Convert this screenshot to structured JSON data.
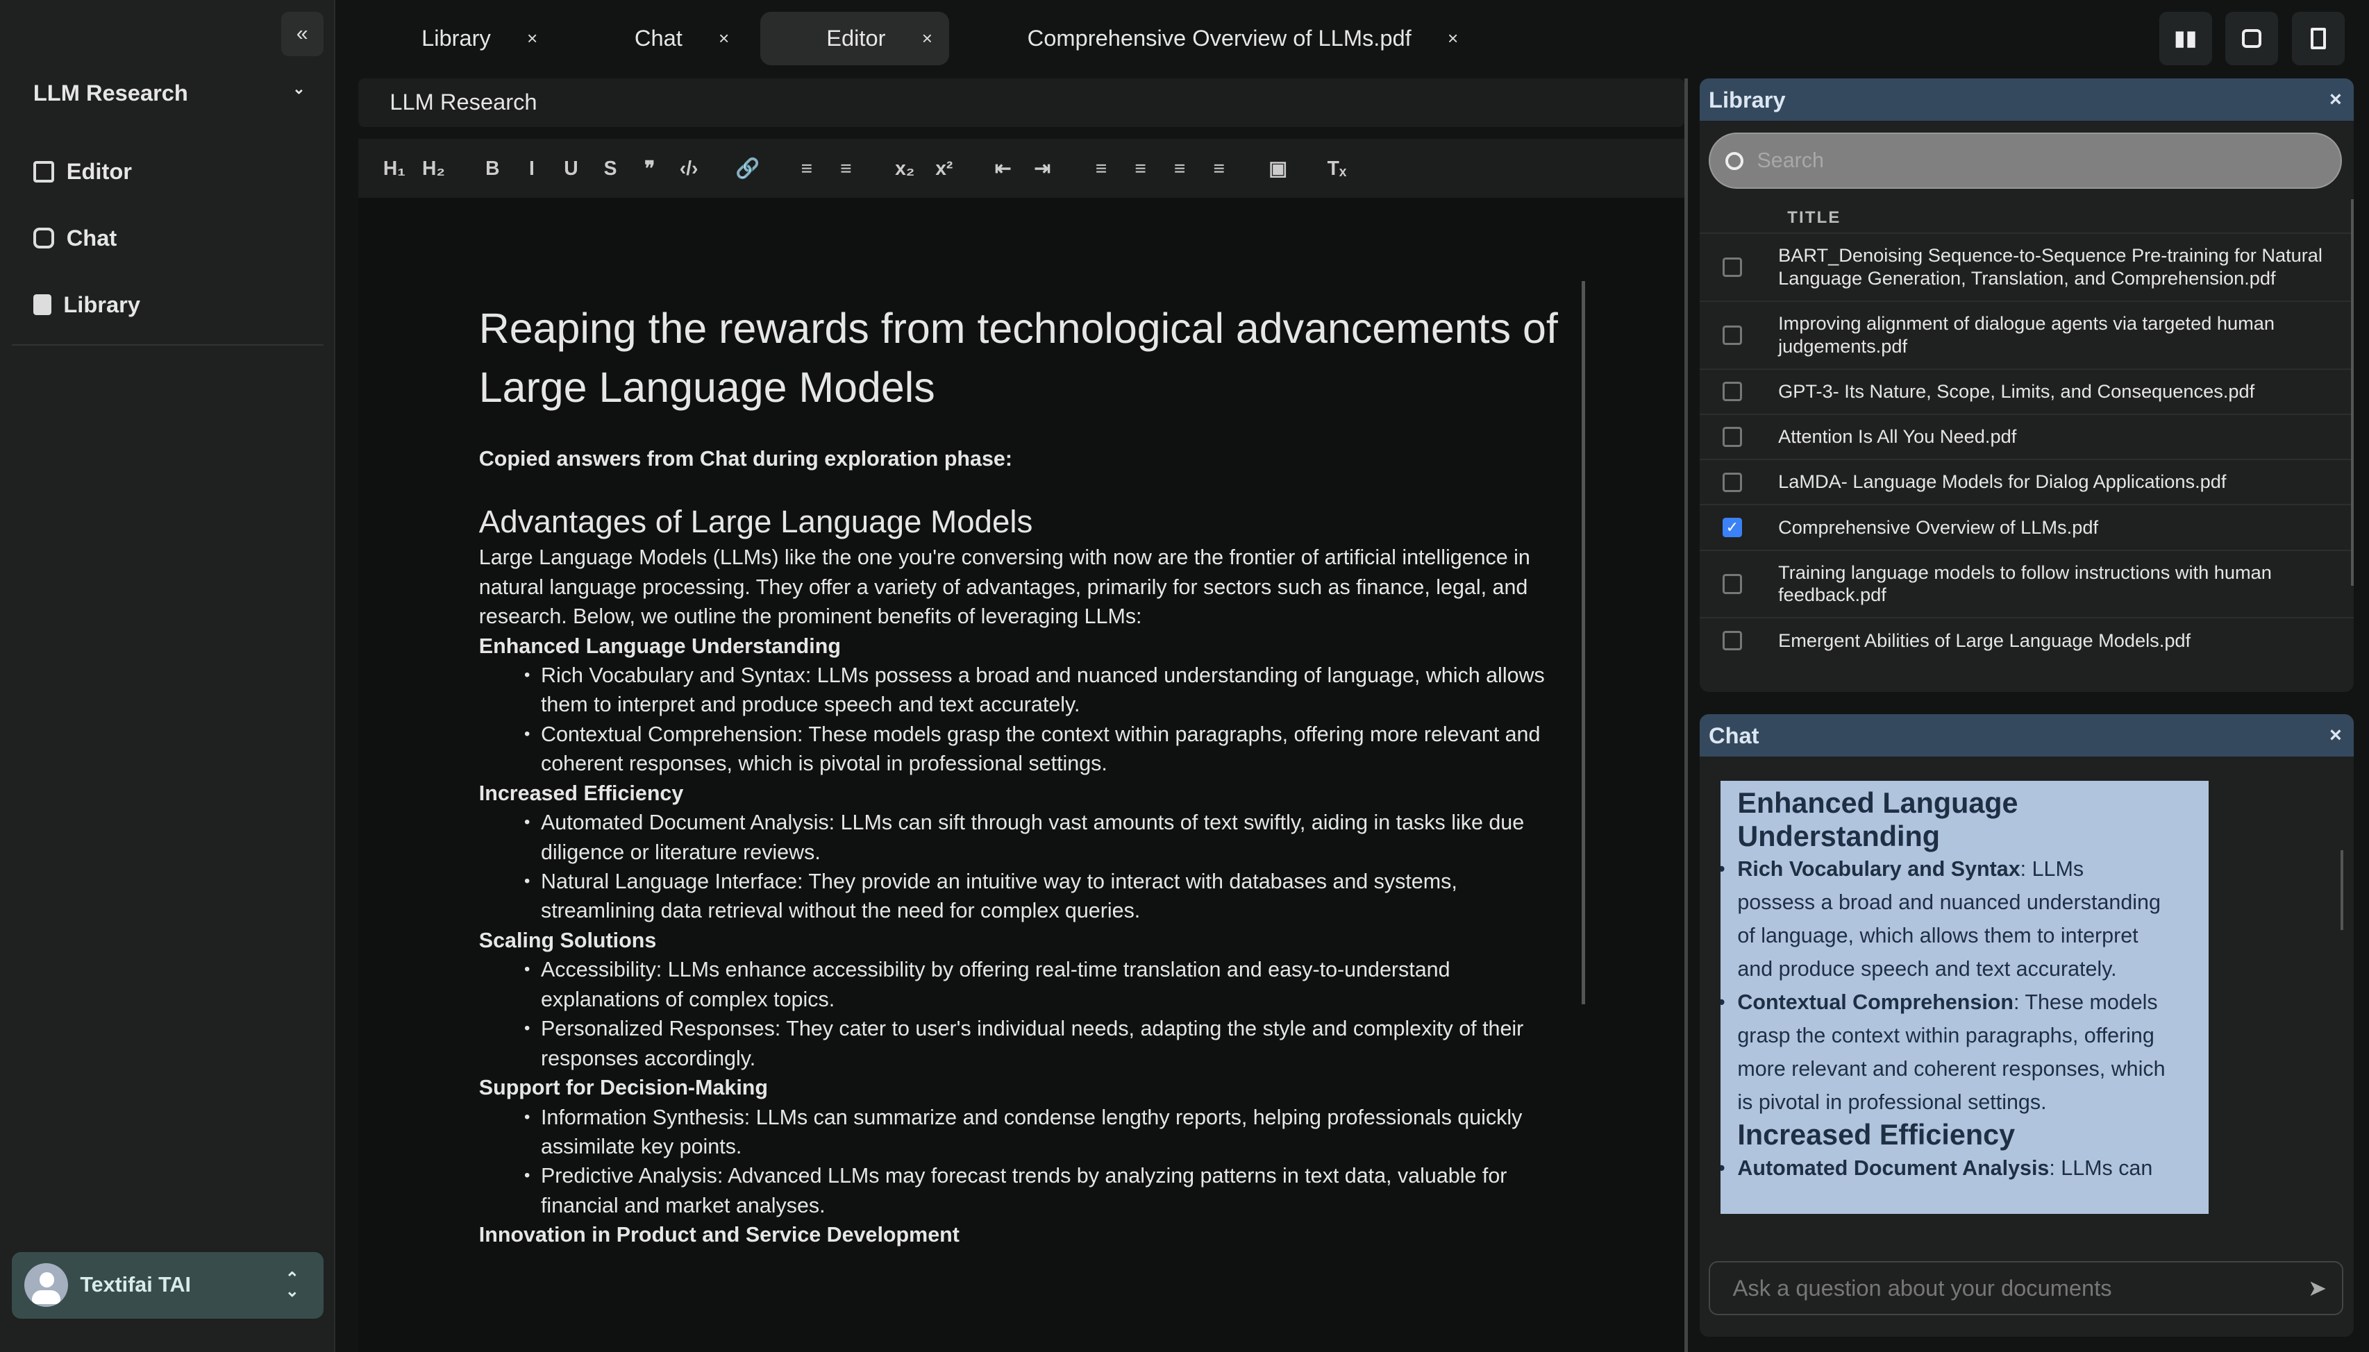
{
  "sidebar": {
    "collapse": "«",
    "workspace": "LLM Research",
    "nav": [
      {
        "label": "Editor"
      },
      {
        "label": "Chat"
      },
      {
        "label": "Library"
      }
    ],
    "user": "Textifai TAI"
  },
  "tabs": [
    {
      "label": "Library"
    },
    {
      "label": "Chat"
    },
    {
      "label": "Editor",
      "active": true
    },
    {
      "label": "Comprehensive Overview of LLMs.pdf"
    }
  ],
  "tab_close": "×",
  "editor": {
    "doc_title": "LLM Research",
    "toolbar": [
      "H₁",
      "H₂",
      "B",
      "I",
      "U",
      "S",
      "❞",
      "‹/›",
      "🔗",
      "≡",
      "≡",
      "x₂",
      "x²",
      "⇤",
      "⇥",
      "≡",
      "≡",
      "≡",
      "≡",
      "▣",
      "Tₓ"
    ],
    "heading": "Reaping the rewards from technological advancements of Large Language Models",
    "intro": "Copied answers from Chat during exploration phase:",
    "h2": "Advantages of Large Language Models",
    "para": "Large Language Models (LLMs) like the one you're conversing with now are the frontier of artificial intelligence in natural language processing. They offer a variety of advantages, primarily for sectors such as finance, legal, and research. Below, we outline the prominent benefits of leveraging LLMs:",
    "sections": [
      {
        "title": "Enhanced Language Understanding",
        "items": [
          "Rich Vocabulary and Syntax: LLMs possess a broad and nuanced understanding of language, which allows them to interpret and produce speech and text accurately.",
          "Contextual Comprehension: These models grasp the context within paragraphs, offering more relevant and coherent responses, which is pivotal in professional settings."
        ]
      },
      {
        "title": "Increased Efficiency",
        "items": [
          "Automated Document Analysis: LLMs can sift through vast amounts of text swiftly, aiding in tasks like due diligence or literature reviews.",
          "Natural Language Interface: They provide an intuitive way to interact with databases and systems, streamlining data retrieval without the need for complex queries."
        ]
      },
      {
        "title": "Scaling Solutions",
        "items": [
          "Accessibility: LLMs enhance accessibility by offering real-time translation and easy-to-understand explanations of complex topics.",
          "Personalized Responses: They cater to user's individual needs, adapting the style and complexity of their responses accordingly."
        ]
      },
      {
        "title": "Support for Decision-Making",
        "items": [
          "Information Synthesis: LLMs can summarize and condense lengthy reports, helping professionals quickly assimilate key points.",
          "Predictive Analysis: Advanced LLMs may forecast trends by analyzing patterns in text data, valuable for financial and market analyses."
        ]
      },
      {
        "title": "Innovation in Product and Service Development",
        "items": []
      }
    ]
  },
  "library": {
    "title": "Library",
    "close": "×",
    "search_placeholder": "Search",
    "column": "TITLE",
    "rows": [
      {
        "title": "BART_Denoising Sequence-to-Sequence Pre-training for Natural Language Generation, Translation, and Comprehension.pdf",
        "checked": false
      },
      {
        "title": "Improving alignment of dialogue agents via targeted human judgements.pdf",
        "checked": false
      },
      {
        "title": "GPT-3- Its Nature, Scope, Limits, and Consequences.pdf",
        "checked": false
      },
      {
        "title": "Attention Is All You Need.pdf",
        "checked": false
      },
      {
        "title": "LaMDA- Language Models for Dialog Applications.pdf",
        "checked": false
      },
      {
        "title": "Comprehensive Overview of LLMs.pdf",
        "checked": true
      },
      {
        "title": "Training language models to follow instructions with human feedback.pdf",
        "checked": false
      },
      {
        "title": "Emergent Abilities of Large Language Models.pdf",
        "checked": false
      }
    ]
  },
  "chat": {
    "title": "Chat",
    "close": "×",
    "placeholder": "Ask a question about your documents",
    "message": {
      "h1": "Enhanced Language Understanding",
      "items": [
        {
          "b": "Rich Vocabulary and Syntax",
          "t": ": LLMs possess a broad and nuanced understanding of language, which allows them to interpret and produce speech and text accurately."
        },
        {
          "b": "Contextual Comprehension",
          "t": ": These models grasp the context within paragraphs, offering more relevant and coherent responses, which is pivotal in professional settings."
        }
      ],
      "h2": "Increased Efficiency",
      "items2": [
        {
          "b": "Automated Document Analysis",
          "t": ": LLMs can"
        }
      ]
    }
  }
}
